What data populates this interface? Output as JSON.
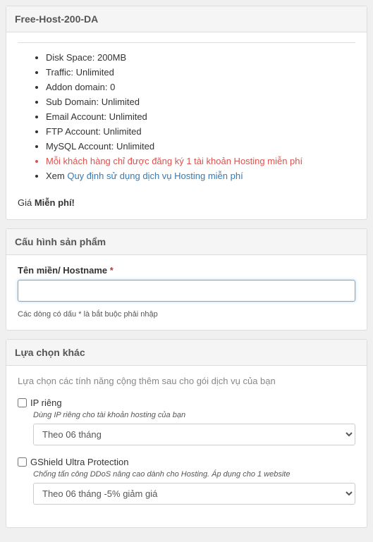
{
  "product": {
    "title": "Free-Host-200-DA",
    "features": [
      "Disk Space: 200MB",
      "Traffic: Unlimited",
      "Addon domain: 0",
      "Sub Domain: Unlimited",
      "Email Account: Unlimited",
      "FTP Account: Unlimited",
      "MySQL Account: Unlimited"
    ],
    "notice_red": "Mỗi khách hàng chỉ được đăng ký 1 tài khoản Hosting miễn phí",
    "see_prefix": "Xem ",
    "see_link": "Quy định sử dụng dịch vụ Hosting miễn phí",
    "price_label": "Giá ",
    "price_value": "Miễn phí!"
  },
  "config": {
    "header": "Cấu hình sản phẩm",
    "hostname_label": "Tên miền/ Hostname",
    "required_mark": "*",
    "hostname_value": "",
    "required_note": "Các dòng có dấu * là bắt buộc phải nhập"
  },
  "options": {
    "header": "Lựa chọn khác",
    "subhead": "Lựa chọn các tính năng cộng thêm sau cho gói dịch vụ của bạn",
    "ip": {
      "label": "IP riêng",
      "desc": "Dùng IP riêng cho tài khoản hosting của bạn",
      "selected": "Theo 06 tháng"
    },
    "gshield": {
      "label": "GShield Ultra Protection",
      "desc": "Chống tấn công DDoS nâng cao dành cho Hosting. Áp dụng cho 1 website",
      "selected": "Theo 06 tháng -5% giảm giá"
    }
  }
}
